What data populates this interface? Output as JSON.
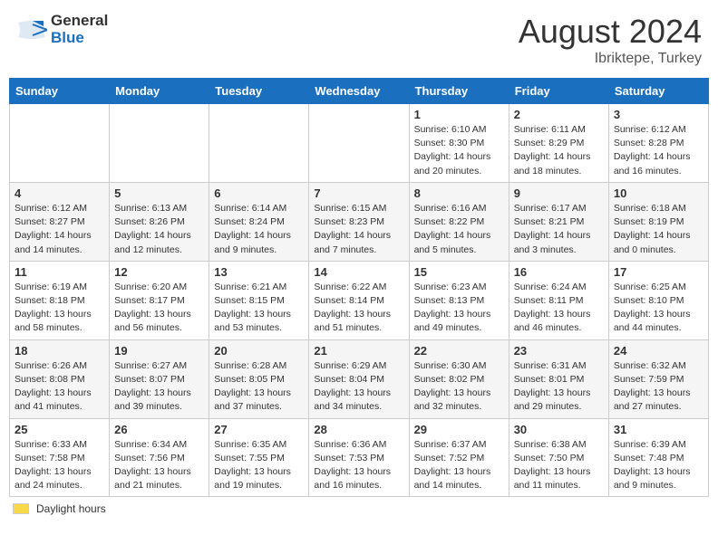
{
  "header": {
    "logo_general": "General",
    "logo_blue": "Blue",
    "month_year": "August 2024",
    "location": "Ibriktepe, Turkey"
  },
  "footer": {
    "label": "Daylight hours"
  },
  "columns": [
    "Sunday",
    "Monday",
    "Tuesday",
    "Wednesday",
    "Thursday",
    "Friday",
    "Saturday"
  ],
  "weeks": [
    [
      {
        "day": "",
        "sunrise": "",
        "sunset": "",
        "daylight": ""
      },
      {
        "day": "",
        "sunrise": "",
        "sunset": "",
        "daylight": ""
      },
      {
        "day": "",
        "sunrise": "",
        "sunset": "",
        "daylight": ""
      },
      {
        "day": "",
        "sunrise": "",
        "sunset": "",
        "daylight": ""
      },
      {
        "day": "1",
        "sunrise": "Sunrise: 6:10 AM",
        "sunset": "Sunset: 8:30 PM",
        "daylight": "Daylight: 14 hours and 20 minutes."
      },
      {
        "day": "2",
        "sunrise": "Sunrise: 6:11 AM",
        "sunset": "Sunset: 8:29 PM",
        "daylight": "Daylight: 14 hours and 18 minutes."
      },
      {
        "day": "3",
        "sunrise": "Sunrise: 6:12 AM",
        "sunset": "Sunset: 8:28 PM",
        "daylight": "Daylight: 14 hours and 16 minutes."
      }
    ],
    [
      {
        "day": "4",
        "sunrise": "Sunrise: 6:12 AM",
        "sunset": "Sunset: 8:27 PM",
        "daylight": "Daylight: 14 hours and 14 minutes."
      },
      {
        "day": "5",
        "sunrise": "Sunrise: 6:13 AM",
        "sunset": "Sunset: 8:26 PM",
        "daylight": "Daylight: 14 hours and 12 minutes."
      },
      {
        "day": "6",
        "sunrise": "Sunrise: 6:14 AM",
        "sunset": "Sunset: 8:24 PM",
        "daylight": "Daylight: 14 hours and 9 minutes."
      },
      {
        "day": "7",
        "sunrise": "Sunrise: 6:15 AM",
        "sunset": "Sunset: 8:23 PM",
        "daylight": "Daylight: 14 hours and 7 minutes."
      },
      {
        "day": "8",
        "sunrise": "Sunrise: 6:16 AM",
        "sunset": "Sunset: 8:22 PM",
        "daylight": "Daylight: 14 hours and 5 minutes."
      },
      {
        "day": "9",
        "sunrise": "Sunrise: 6:17 AM",
        "sunset": "Sunset: 8:21 PM",
        "daylight": "Daylight: 14 hours and 3 minutes."
      },
      {
        "day": "10",
        "sunrise": "Sunrise: 6:18 AM",
        "sunset": "Sunset: 8:19 PM",
        "daylight": "Daylight: 14 hours and 0 minutes."
      }
    ],
    [
      {
        "day": "11",
        "sunrise": "Sunrise: 6:19 AM",
        "sunset": "Sunset: 8:18 PM",
        "daylight": "Daylight: 13 hours and 58 minutes."
      },
      {
        "day": "12",
        "sunrise": "Sunrise: 6:20 AM",
        "sunset": "Sunset: 8:17 PM",
        "daylight": "Daylight: 13 hours and 56 minutes."
      },
      {
        "day": "13",
        "sunrise": "Sunrise: 6:21 AM",
        "sunset": "Sunset: 8:15 PM",
        "daylight": "Daylight: 13 hours and 53 minutes."
      },
      {
        "day": "14",
        "sunrise": "Sunrise: 6:22 AM",
        "sunset": "Sunset: 8:14 PM",
        "daylight": "Daylight: 13 hours and 51 minutes."
      },
      {
        "day": "15",
        "sunrise": "Sunrise: 6:23 AM",
        "sunset": "Sunset: 8:13 PM",
        "daylight": "Daylight: 13 hours and 49 minutes."
      },
      {
        "day": "16",
        "sunrise": "Sunrise: 6:24 AM",
        "sunset": "Sunset: 8:11 PM",
        "daylight": "Daylight: 13 hours and 46 minutes."
      },
      {
        "day": "17",
        "sunrise": "Sunrise: 6:25 AM",
        "sunset": "Sunset: 8:10 PM",
        "daylight": "Daylight: 13 hours and 44 minutes."
      }
    ],
    [
      {
        "day": "18",
        "sunrise": "Sunrise: 6:26 AM",
        "sunset": "Sunset: 8:08 PM",
        "daylight": "Daylight: 13 hours and 41 minutes."
      },
      {
        "day": "19",
        "sunrise": "Sunrise: 6:27 AM",
        "sunset": "Sunset: 8:07 PM",
        "daylight": "Daylight: 13 hours and 39 minutes."
      },
      {
        "day": "20",
        "sunrise": "Sunrise: 6:28 AM",
        "sunset": "Sunset: 8:05 PM",
        "daylight": "Daylight: 13 hours and 37 minutes."
      },
      {
        "day": "21",
        "sunrise": "Sunrise: 6:29 AM",
        "sunset": "Sunset: 8:04 PM",
        "daylight": "Daylight: 13 hours and 34 minutes."
      },
      {
        "day": "22",
        "sunrise": "Sunrise: 6:30 AM",
        "sunset": "Sunset: 8:02 PM",
        "daylight": "Daylight: 13 hours and 32 minutes."
      },
      {
        "day": "23",
        "sunrise": "Sunrise: 6:31 AM",
        "sunset": "Sunset: 8:01 PM",
        "daylight": "Daylight: 13 hours and 29 minutes."
      },
      {
        "day": "24",
        "sunrise": "Sunrise: 6:32 AM",
        "sunset": "Sunset: 7:59 PM",
        "daylight": "Daylight: 13 hours and 27 minutes."
      }
    ],
    [
      {
        "day": "25",
        "sunrise": "Sunrise: 6:33 AM",
        "sunset": "Sunset: 7:58 PM",
        "daylight": "Daylight: 13 hours and 24 minutes."
      },
      {
        "day": "26",
        "sunrise": "Sunrise: 6:34 AM",
        "sunset": "Sunset: 7:56 PM",
        "daylight": "Daylight: 13 hours and 21 minutes."
      },
      {
        "day": "27",
        "sunrise": "Sunrise: 6:35 AM",
        "sunset": "Sunset: 7:55 PM",
        "daylight": "Daylight: 13 hours and 19 minutes."
      },
      {
        "day": "28",
        "sunrise": "Sunrise: 6:36 AM",
        "sunset": "Sunset: 7:53 PM",
        "daylight": "Daylight: 13 hours and 16 minutes."
      },
      {
        "day": "29",
        "sunrise": "Sunrise: 6:37 AM",
        "sunset": "Sunset: 7:52 PM",
        "daylight": "Daylight: 13 hours and 14 minutes."
      },
      {
        "day": "30",
        "sunrise": "Sunrise: 6:38 AM",
        "sunset": "Sunset: 7:50 PM",
        "daylight": "Daylight: 13 hours and 11 minutes."
      },
      {
        "day": "31",
        "sunrise": "Sunrise: 6:39 AM",
        "sunset": "Sunset: 7:48 PM",
        "daylight": "Daylight: 13 hours and 9 minutes."
      }
    ]
  ]
}
